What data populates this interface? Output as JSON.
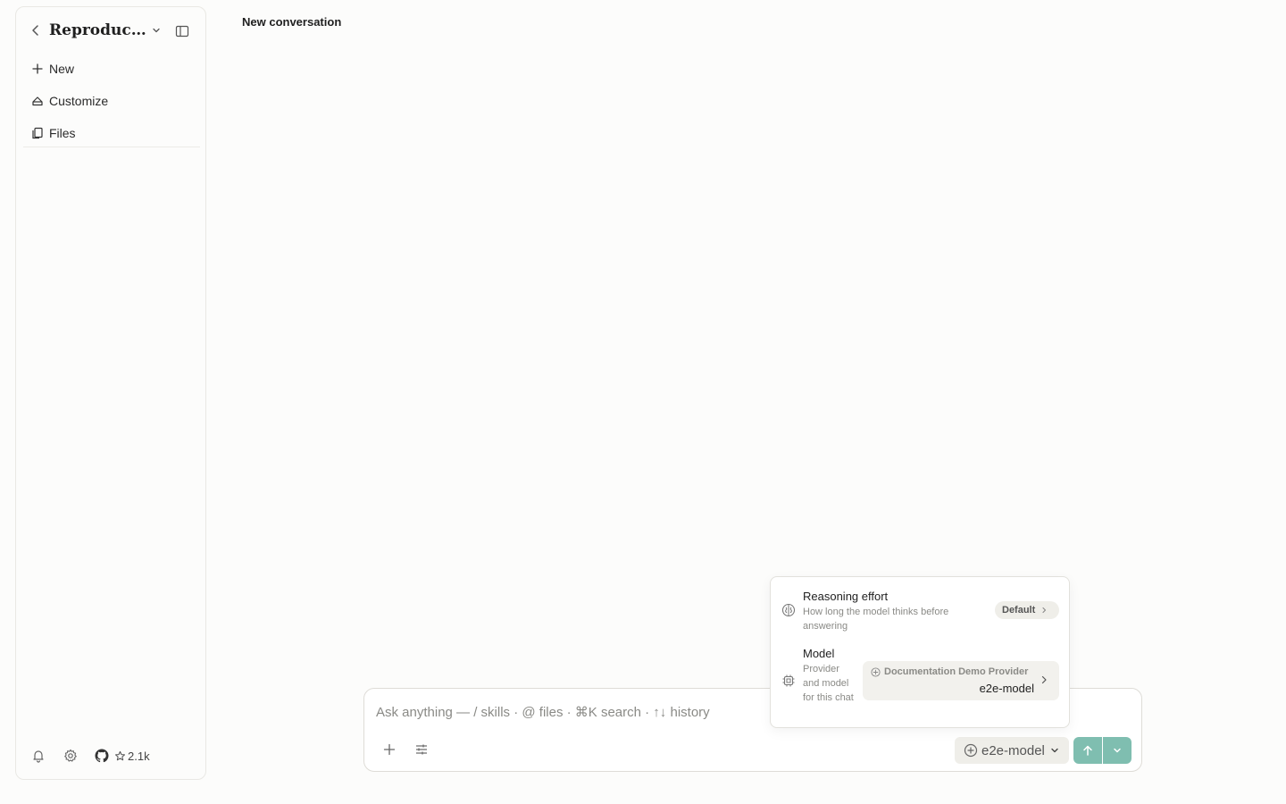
{
  "sidebar": {
    "project_title": "Reproducibl...",
    "nav": {
      "new_label": "New",
      "customize_label": "Customize",
      "files_label": "Files"
    },
    "footer": {
      "stars": "2.1k"
    }
  },
  "main": {
    "title": "New conversation"
  },
  "composer": {
    "placeholder": "Ask anything — / skills · @ files · ⌘K search · ↑↓ history",
    "model_label": "e2e-model"
  },
  "popover": {
    "reasoning": {
      "title": "Reasoning effort",
      "description": "How long the model thinks before answering",
      "value": "Default"
    },
    "model": {
      "title": "Model",
      "description": "Provider and model for this chat",
      "provider": "Documentation Demo Provider",
      "model_name": "e2e-model"
    }
  },
  "colors": {
    "accent": "#7fbeb0",
    "background": "#fcfcfb",
    "chip": "#efeee9"
  },
  "icons": [
    "chevron-left-icon",
    "chevron-down-icon",
    "sidebar-toggle-icon",
    "plus-icon",
    "palette-icon",
    "files-icon",
    "bell-icon",
    "gear-icon",
    "github-icon",
    "star-icon",
    "sliders-icon",
    "model-icon",
    "arrow-up-icon",
    "brain-icon",
    "chip-icon",
    "chevron-right-icon"
  ]
}
